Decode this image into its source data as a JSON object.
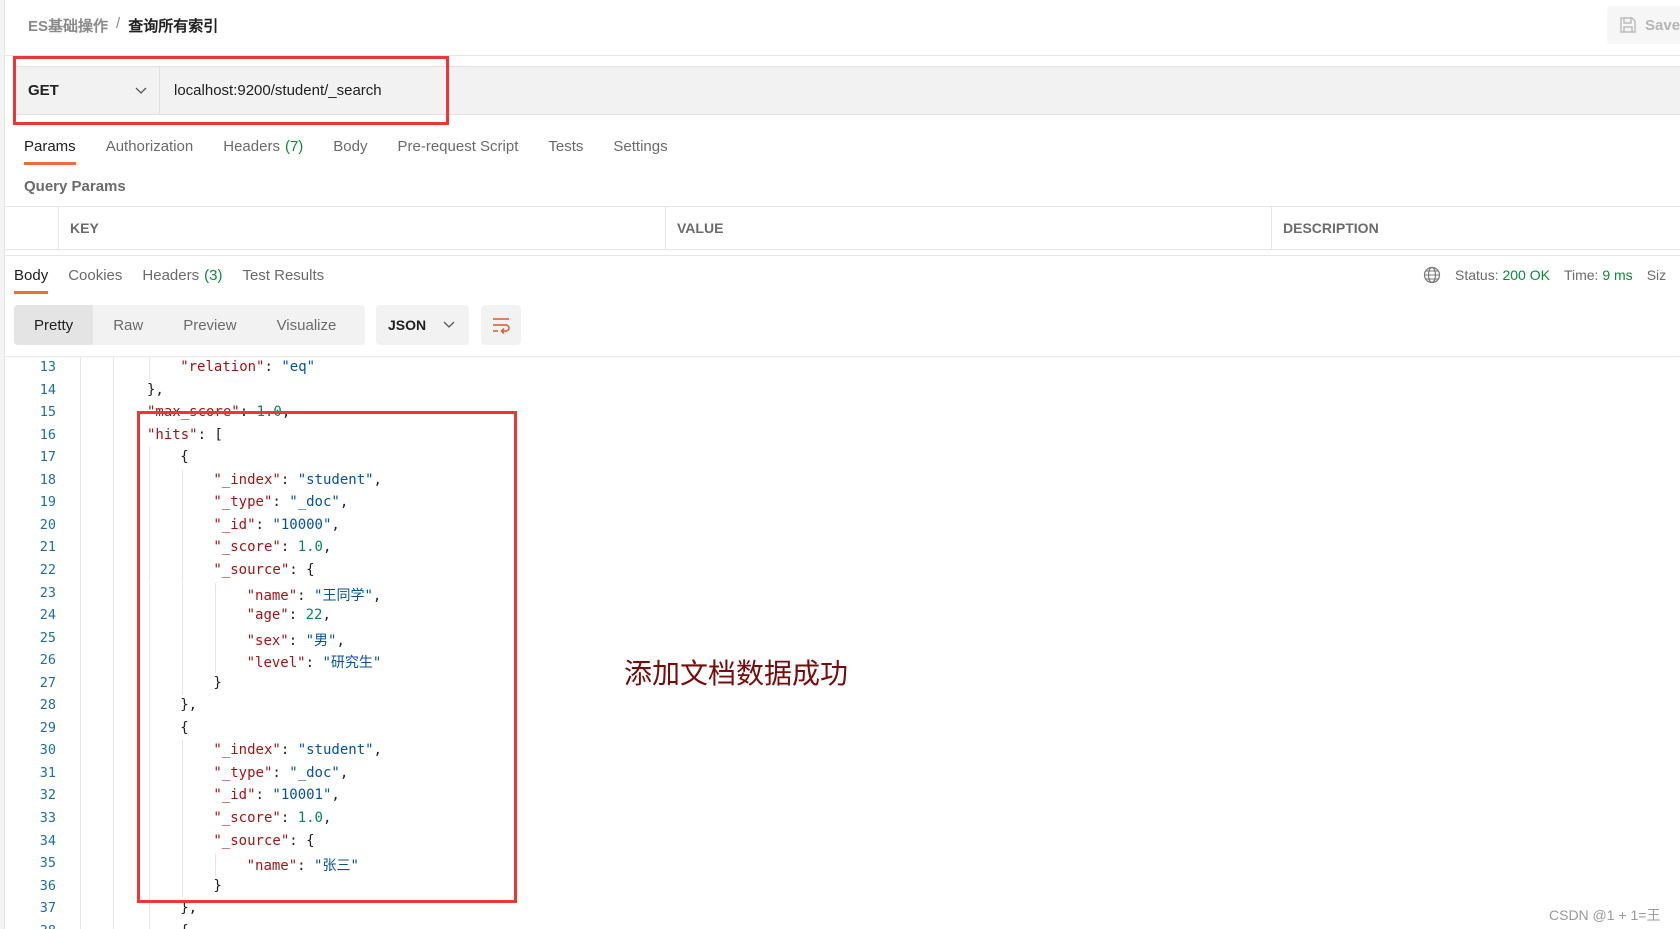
{
  "breadcrumb": {
    "parent": "ES基础操作",
    "separator": "/",
    "current": "查询所有索引"
  },
  "save_label": "Save",
  "request": {
    "method": "GET",
    "url": "localhost:9200/student/_search"
  },
  "request_tabs": [
    {
      "label": "Params",
      "active": true
    },
    {
      "label": "Authorization"
    },
    {
      "label": "Headers",
      "count": "(7)"
    },
    {
      "label": "Body"
    },
    {
      "label": "Pre-request Script"
    },
    {
      "label": "Tests"
    },
    {
      "label": "Settings"
    }
  ],
  "query_params": {
    "title": "Query Params",
    "columns": [
      "KEY",
      "VALUE",
      "DESCRIPTION"
    ]
  },
  "response_tabs": [
    {
      "label": "Body",
      "active": true
    },
    {
      "label": "Cookies"
    },
    {
      "label": "Headers",
      "count": "(3)"
    },
    {
      "label": "Test Results"
    }
  ],
  "status": {
    "status_label": "Status:",
    "status_value": "200 OK",
    "time_label": "Time:",
    "time_value": "9 ms",
    "size_label": "Siz"
  },
  "view_modes": [
    "Pretty",
    "Raw",
    "Preview",
    "Visualize"
  ],
  "format": "JSON",
  "colors": {
    "accent": "#f26b3a",
    "success": "#0a8a3a",
    "highlight_box": "#f03535",
    "annotation": "#7b0a0a"
  },
  "code_lines": [
    {
      "n": "13",
      "i": 1,
      "t": [
        [
          "k",
          "\"relation\""
        ],
        [
          "p",
          ": "
        ],
        [
          "s",
          "\"eq\""
        ]
      ]
    },
    {
      "n": "14",
      "i": 0,
      "t": [
        [
          "p",
          "},"
        ]
      ]
    },
    {
      "n": "15",
      "i": 0,
      "t": [
        [
          "k",
          "\"max_score\""
        ],
        [
          "p",
          ": "
        ],
        [
          "n",
          "1.0"
        ],
        [
          "p",
          ","
        ]
      ]
    },
    {
      "n": "16",
      "i": 0,
      "t": [
        [
          "k",
          "\"hits\""
        ],
        [
          "p",
          ": ["
        ]
      ]
    },
    {
      "n": "17",
      "i": 1,
      "t": [
        [
          "p",
          "{"
        ]
      ]
    },
    {
      "n": "18",
      "i": 2,
      "t": [
        [
          "k",
          "\"_index\""
        ],
        [
          "p",
          ": "
        ],
        [
          "s",
          "\"student\""
        ],
        [
          "p",
          ","
        ]
      ]
    },
    {
      "n": "19",
      "i": 2,
      "t": [
        [
          "k",
          "\"_type\""
        ],
        [
          "p",
          ": "
        ],
        [
          "s",
          "\"_doc\""
        ],
        [
          "p",
          ","
        ]
      ]
    },
    {
      "n": "20",
      "i": 2,
      "t": [
        [
          "k",
          "\"_id\""
        ],
        [
          "p",
          ": "
        ],
        [
          "s",
          "\"10000\""
        ],
        [
          "p",
          ","
        ]
      ]
    },
    {
      "n": "21",
      "i": 2,
      "t": [
        [
          "k",
          "\"_score\""
        ],
        [
          "p",
          ": "
        ],
        [
          "n",
          "1.0"
        ],
        [
          "p",
          ","
        ]
      ]
    },
    {
      "n": "22",
      "i": 2,
      "t": [
        [
          "k",
          "\"_source\""
        ],
        [
          "p",
          ": {"
        ]
      ]
    },
    {
      "n": "23",
      "i": 3,
      "t": [
        [
          "k",
          "\"name\""
        ],
        [
          "p",
          ": "
        ],
        [
          "s",
          "\"王同学\""
        ],
        [
          "p",
          ","
        ]
      ]
    },
    {
      "n": "24",
      "i": 3,
      "t": [
        [
          "k",
          "\"age\""
        ],
        [
          "p",
          ": "
        ],
        [
          "n",
          "22"
        ],
        [
          "p",
          ","
        ]
      ]
    },
    {
      "n": "25",
      "i": 3,
      "t": [
        [
          "k",
          "\"sex\""
        ],
        [
          "p",
          ": "
        ],
        [
          "s",
          "\"男\""
        ],
        [
          "p",
          ","
        ]
      ]
    },
    {
      "n": "26",
      "i": 3,
      "t": [
        [
          "k",
          "\"level\""
        ],
        [
          "p",
          ": "
        ],
        [
          "s",
          "\"研究生\""
        ]
      ]
    },
    {
      "n": "27",
      "i": 2,
      "t": [
        [
          "p",
          "}"
        ]
      ]
    },
    {
      "n": "28",
      "i": 1,
      "t": [
        [
          "p",
          "},"
        ]
      ]
    },
    {
      "n": "29",
      "i": 1,
      "t": [
        [
          "p",
          "{"
        ]
      ]
    },
    {
      "n": "30",
      "i": 2,
      "t": [
        [
          "k",
          "\"_index\""
        ],
        [
          "p",
          ": "
        ],
        [
          "s",
          "\"student\""
        ],
        [
          "p",
          ","
        ]
      ]
    },
    {
      "n": "31",
      "i": 2,
      "t": [
        [
          "k",
          "\"_type\""
        ],
        [
          "p",
          ": "
        ],
        [
          "s",
          "\"_doc\""
        ],
        [
          "p",
          ","
        ]
      ]
    },
    {
      "n": "32",
      "i": 2,
      "t": [
        [
          "k",
          "\"_id\""
        ],
        [
          "p",
          ": "
        ],
        [
          "s",
          "\"10001\""
        ],
        [
          "p",
          ","
        ]
      ]
    },
    {
      "n": "33",
      "i": 2,
      "t": [
        [
          "k",
          "\"_score\""
        ],
        [
          "p",
          ": "
        ],
        [
          "n",
          "1.0"
        ],
        [
          "p",
          ","
        ]
      ]
    },
    {
      "n": "34",
      "i": 2,
      "t": [
        [
          "k",
          "\"_source\""
        ],
        [
          "p",
          ": {"
        ]
      ]
    },
    {
      "n": "35",
      "i": 3,
      "t": [
        [
          "k",
          "\"name\""
        ],
        [
          "p",
          ": "
        ],
        [
          "s",
          "\"张三\""
        ]
      ]
    },
    {
      "n": "36",
      "i": 2,
      "t": [
        [
          "p",
          "}"
        ]
      ]
    },
    {
      "n": "37",
      "i": 1,
      "t": [
        [
          "p",
          "},"
        ]
      ]
    },
    {
      "n": "38",
      "i": 1,
      "t": [
        [
          "p",
          "{"
        ]
      ]
    }
  ],
  "annotation": "添加文档数据成功",
  "watermark": "CSDN @1 + 1=王"
}
